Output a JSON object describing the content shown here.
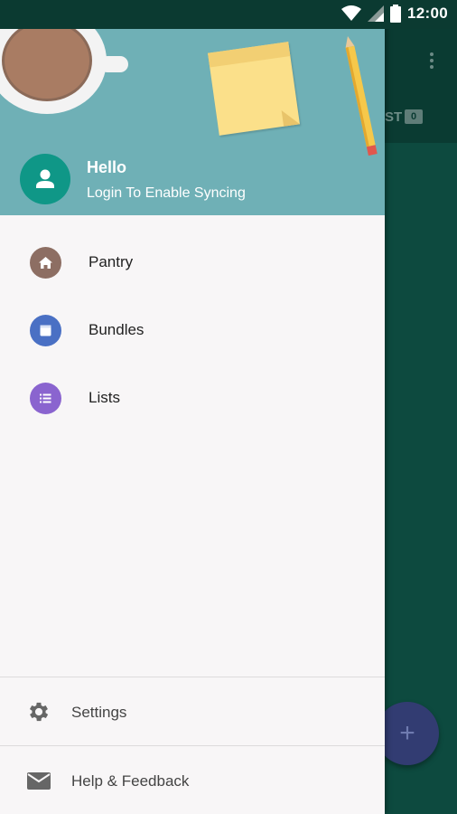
{
  "status_bar": {
    "time": "12:00"
  },
  "drawer": {
    "header": {
      "greeting": "Hello",
      "subtitle": "Login To Enable Syncing"
    },
    "nav_items": [
      {
        "label": "Pantry",
        "icon": "home-icon",
        "color": "#8d6e63"
      },
      {
        "label": "Bundles",
        "icon": "bundle-icon",
        "color": "#4a70c4"
      },
      {
        "label": "Lists",
        "icon": "list-icon",
        "color": "#8a64cf"
      }
    ],
    "footer_items": [
      {
        "label": "Settings",
        "icon": "gear-icon"
      },
      {
        "label": "Help & Feedback",
        "icon": "mail-icon"
      }
    ]
  },
  "background_app": {
    "tab_fragment": "ST",
    "tab_count": "0",
    "fab_label": "+"
  },
  "colors": {
    "header_bg": "#6fb0b6",
    "avatar_bg": "#0f9787",
    "drawer_bg": "#f8f6f7",
    "app_bg": "#0d4a3f"
  }
}
